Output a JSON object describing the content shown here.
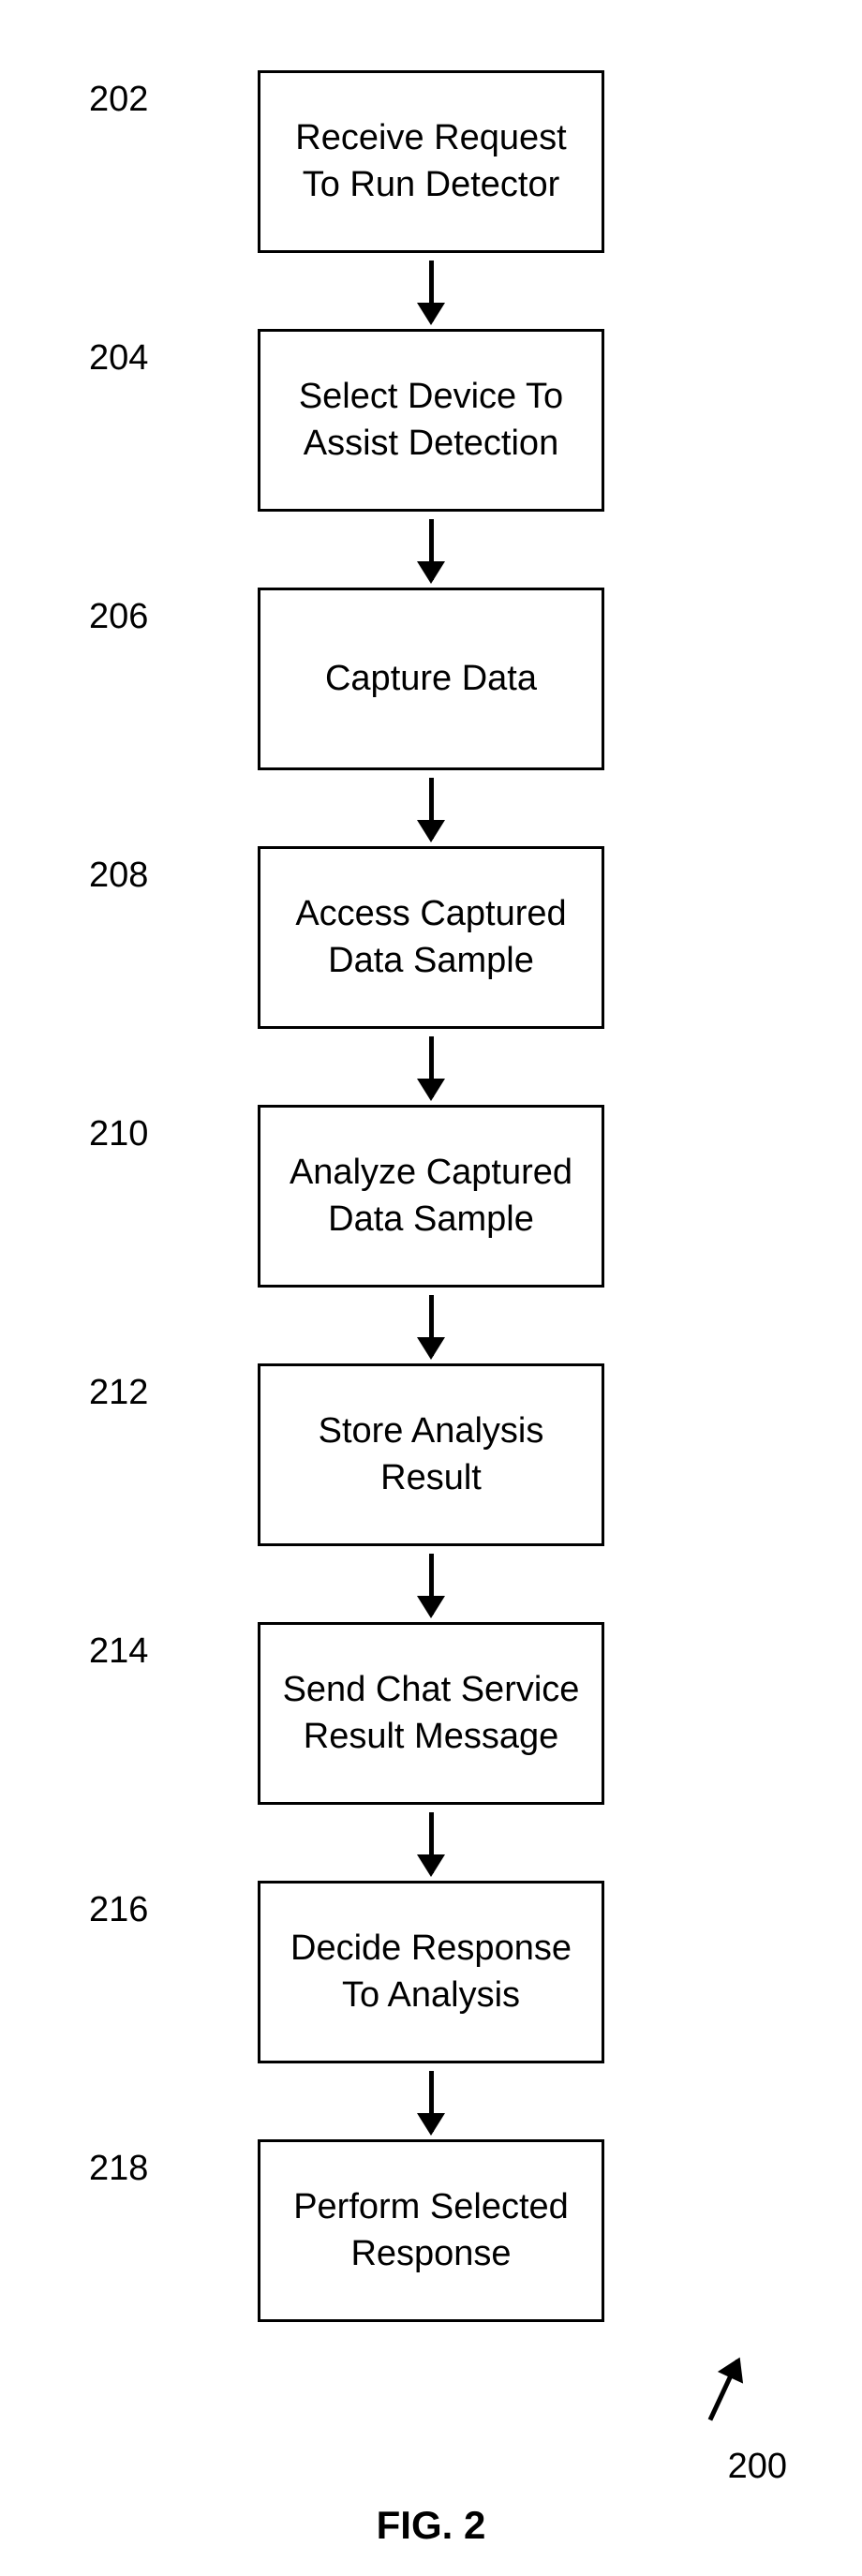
{
  "steps": [
    {
      "number": "202",
      "text": "Receive Request To Run Detector"
    },
    {
      "number": "204",
      "text": "Select Device To Assist Detection"
    },
    {
      "number": "206",
      "text": "Capture Data"
    },
    {
      "number": "208",
      "text": "Access Captured Data Sample"
    },
    {
      "number": "210",
      "text": "Analyze Captured Data Sample"
    },
    {
      "number": "212",
      "text": "Store Analysis Result"
    },
    {
      "number": "214",
      "text": "Send Chat Service Result Message"
    },
    {
      "number": "216",
      "text": "Decide Response To Analysis"
    },
    {
      "number": "218",
      "text": "Perform Selected Response"
    }
  ],
  "footer_number": "200",
  "figure_label": "FIG. 2"
}
